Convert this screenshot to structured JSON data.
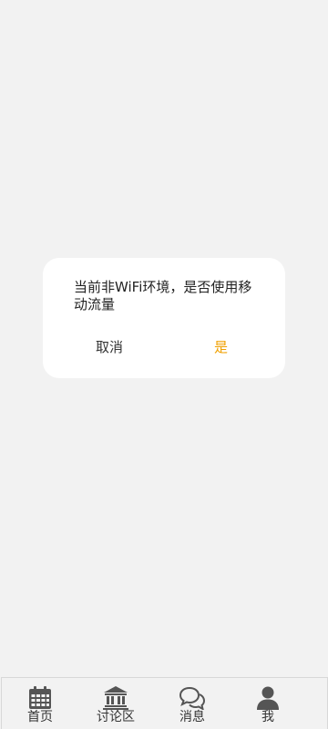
{
  "dialog": {
    "message": "当前非WiFi环境，是否使用移动流量",
    "cancel_label": "取消",
    "confirm_label": "是",
    "confirm_color": "#f0a000"
  },
  "tabbar": {
    "items": [
      {
        "label": "首页",
        "icon": "calendar-icon"
      },
      {
        "label": "讨论区",
        "icon": "bank-icon"
      },
      {
        "label": "消息",
        "icon": "chat-bubbles-icon"
      },
      {
        "label": "我",
        "icon": "user-icon"
      }
    ]
  }
}
